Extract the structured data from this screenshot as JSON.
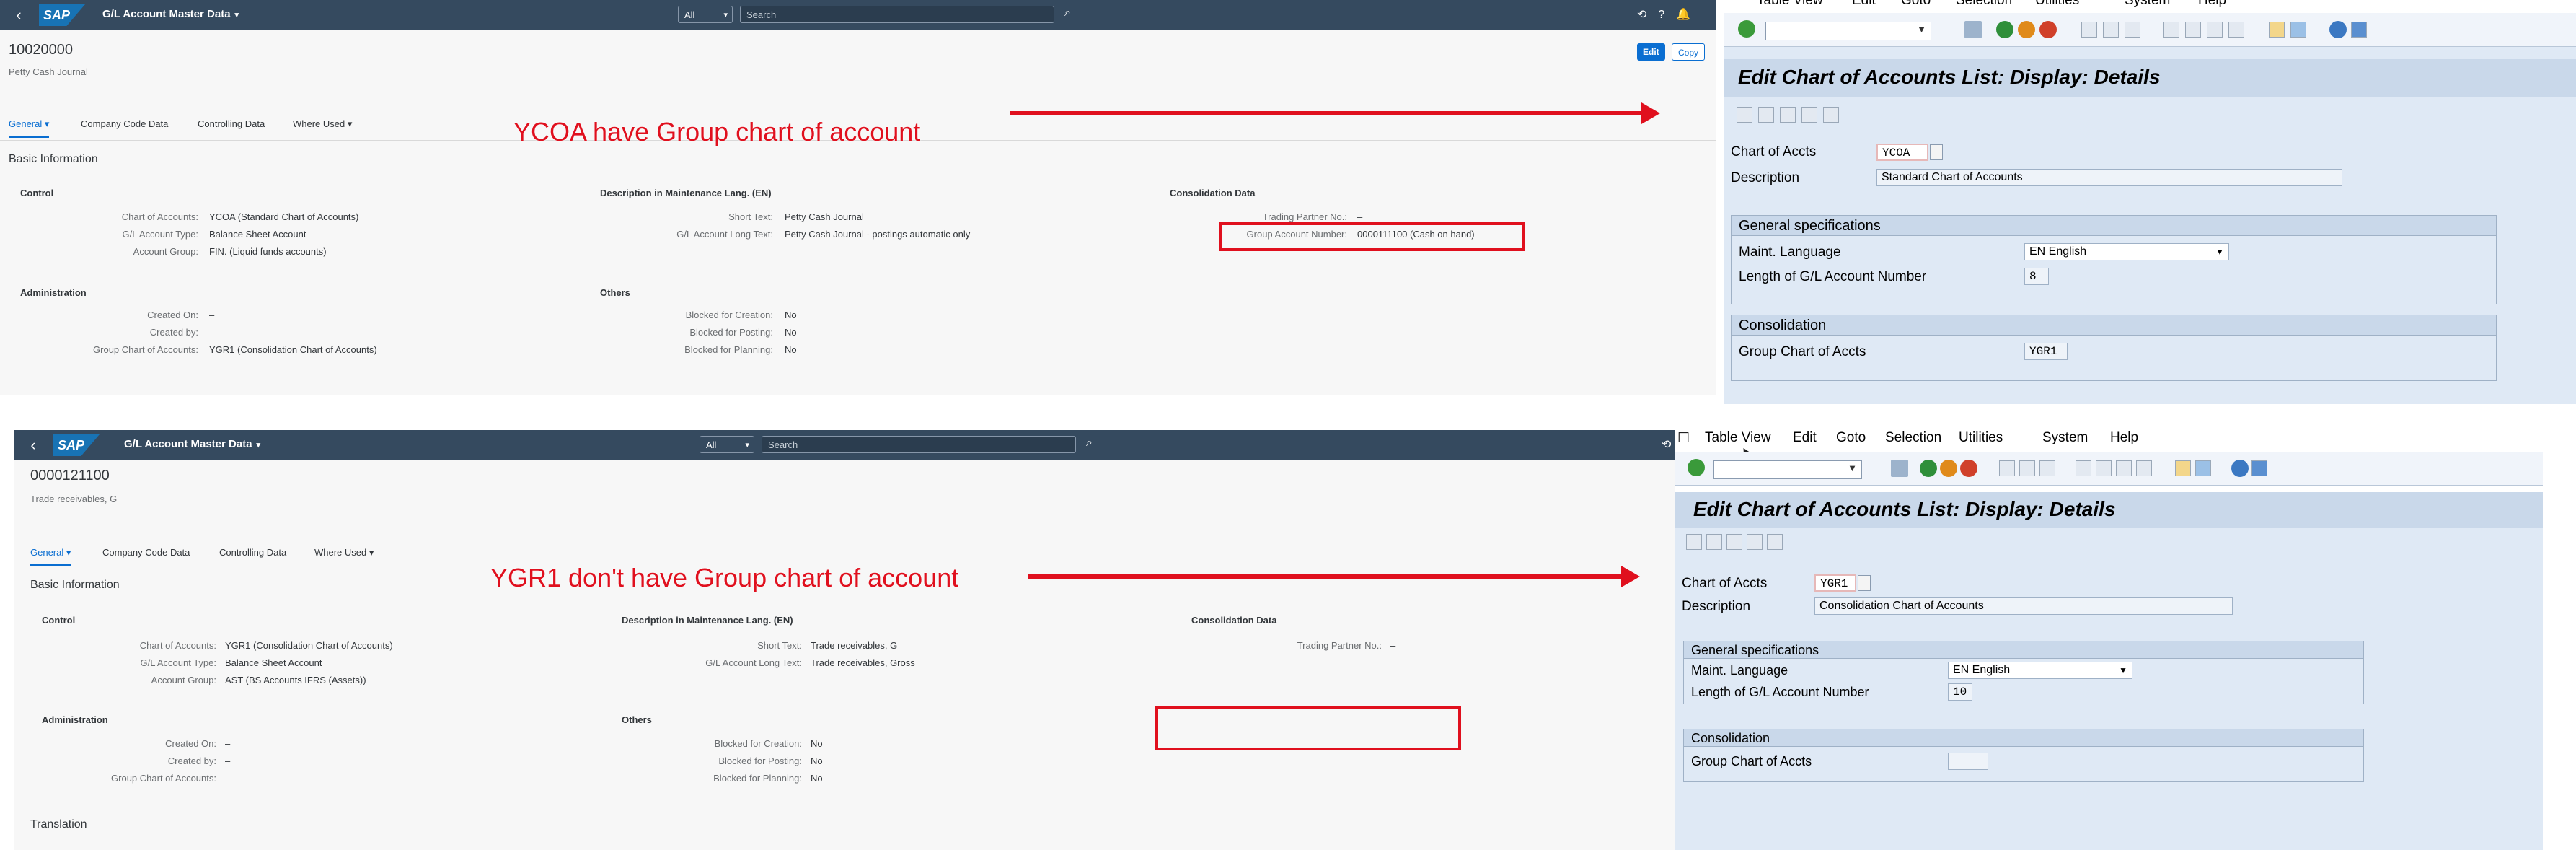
{
  "colors": {
    "shell": "#354a5f",
    "fiori_link": "#0a6ed1",
    "annotation_red": "#e0101e",
    "gui_bg": "#dfe9f5",
    "gui_header": "#c9d8ea"
  },
  "top_fiori": {
    "shell": {
      "app_title": "G/L Account Master Data",
      "scope": "All",
      "search_placeholder": "Search",
      "logo": "SAP"
    },
    "object_id": "10020000",
    "object_sub": "Petty Cash Journal",
    "buttons": {
      "edit": "Edit",
      "copy": "Copy"
    },
    "tabs": [
      "General",
      "Company Code Data",
      "Controlling Data",
      "Where Used"
    ],
    "section": "Basic Information",
    "groups": {
      "control": {
        "title": "Control",
        "rows": [
          {
            "label": "Chart of Accounts:",
            "value": "YCOA (Standard Chart of Accounts)"
          },
          {
            "label": "G/L Account Type:",
            "value": "Balance Sheet Account"
          },
          {
            "label": "Account Group:",
            "value": "FIN. (Liquid funds accounts)"
          }
        ]
      },
      "description": {
        "title": "Description in Maintenance Lang. (EN)",
        "rows": [
          {
            "label": "Short Text:",
            "value": "Petty Cash Journal"
          },
          {
            "label": "G/L Account Long Text:",
            "value": "Petty Cash Journal - postings automatic only"
          }
        ]
      },
      "consolidation": {
        "title": "Consolidation Data",
        "rows": [
          {
            "label": "Trading Partner No.:",
            "value": "–"
          },
          {
            "label": "Group Account Number:",
            "value": "0000111100 (Cash on hand)"
          }
        ]
      },
      "administration": {
        "title": "Administration",
        "rows": [
          {
            "label": "Created On:",
            "value": "–"
          },
          {
            "label": "Created by:",
            "value": "–"
          },
          {
            "label": "Group Chart of Accounts:",
            "value": "YGR1 (Consolidation Chart of Accounts)"
          }
        ]
      },
      "others": {
        "title": "Others",
        "rows": [
          {
            "label": "Blocked for Creation:",
            "value": "No"
          },
          {
            "label": "Blocked for Posting:",
            "value": "No"
          },
          {
            "label": "Blocked for Planning:",
            "value": "No"
          }
        ]
      }
    },
    "annotation": "YCOA have Group chart of account"
  },
  "bottom_fiori": {
    "shell": {
      "app_title": "G/L Account Master Data",
      "scope": "All",
      "search_placeholder": "Search",
      "logo": "SAP"
    },
    "object_id": "0000121100",
    "object_sub": "Trade receivables, G",
    "tabs": [
      "General",
      "Company Code Data",
      "Controlling Data",
      "Where Used"
    ],
    "section": "Basic Information",
    "groups": {
      "control": {
        "title": "Control",
        "rows": [
          {
            "label": "Chart of Accounts:",
            "value": "YGR1 (Consolidation Chart of Accounts)"
          },
          {
            "label": "G/L Account Type:",
            "value": "Balance Sheet Account"
          },
          {
            "label": "Account Group:",
            "value": "AST (BS Accounts IFRS (Assets))"
          }
        ]
      },
      "description": {
        "title": "Description in Maintenance Lang. (EN)",
        "rows": [
          {
            "label": "Short Text:",
            "value": "Trade receivables, G"
          },
          {
            "label": "G/L Account Long Text:",
            "value": "Trade receivables, Gross"
          }
        ]
      },
      "consolidation": {
        "title": "Consolidation Data",
        "rows": [
          {
            "label": "Trading Partner No.:",
            "value": "–"
          }
        ]
      },
      "administration": {
        "title": "Administration",
        "rows": [
          {
            "label": "Created On:",
            "value": "–"
          },
          {
            "label": "Created by:",
            "value": "–"
          },
          {
            "label": "Group Chart of Accounts:",
            "value": "–"
          }
        ]
      },
      "others": {
        "title": "Others",
        "rows": [
          {
            "label": "Blocked for Creation:",
            "value": "No"
          },
          {
            "label": "Blocked for Posting:",
            "value": "No"
          },
          {
            "label": "Blocked for Planning:",
            "value": "No"
          }
        ]
      }
    },
    "translation": "Translation",
    "annotation": "YGR1 don't have Group chart of account"
  },
  "top_gui": {
    "menu": [
      "Table View",
      "Edit",
      "Goto",
      "Selection",
      "Utilities",
      "System",
      "Help"
    ],
    "title": "Edit Chart of Accounts List: Display: Details",
    "chart_of_accts_label": "Chart of Accts",
    "chart_of_accts_value": "YCOA",
    "description_label": "Description",
    "description_value": "Standard Chart of Accounts",
    "general_spec_title": "General specifications",
    "maint_lang_label": "Maint. Language",
    "maint_lang_value": "EN English",
    "length_label": "Length of G/L Account Number",
    "length_value": "8",
    "consolidation_title": "Consolidation",
    "group_coa_label": "Group Chart of Accts",
    "group_coa_value": "YGR1"
  },
  "bottom_gui": {
    "menu": [
      "Table View",
      "Edit",
      "Goto",
      "Selection",
      "Utilities",
      "System",
      "Help"
    ],
    "title": "Edit Chart of Accounts List: Display: Details",
    "chart_of_accts_label": "Chart of Accts",
    "chart_of_accts_value": "YGR1",
    "description_label": "Description",
    "description_value": "Consolidation Chart of Accounts",
    "general_spec_title": "General specifications",
    "maint_lang_label": "Maint. Language",
    "maint_lang_value": "EN English",
    "length_label": "Length of G/L Account Number",
    "length_value": "10",
    "consolidation_title": "Consolidation",
    "group_coa_label": "Group Chart of Accts",
    "group_coa_value": ""
  }
}
